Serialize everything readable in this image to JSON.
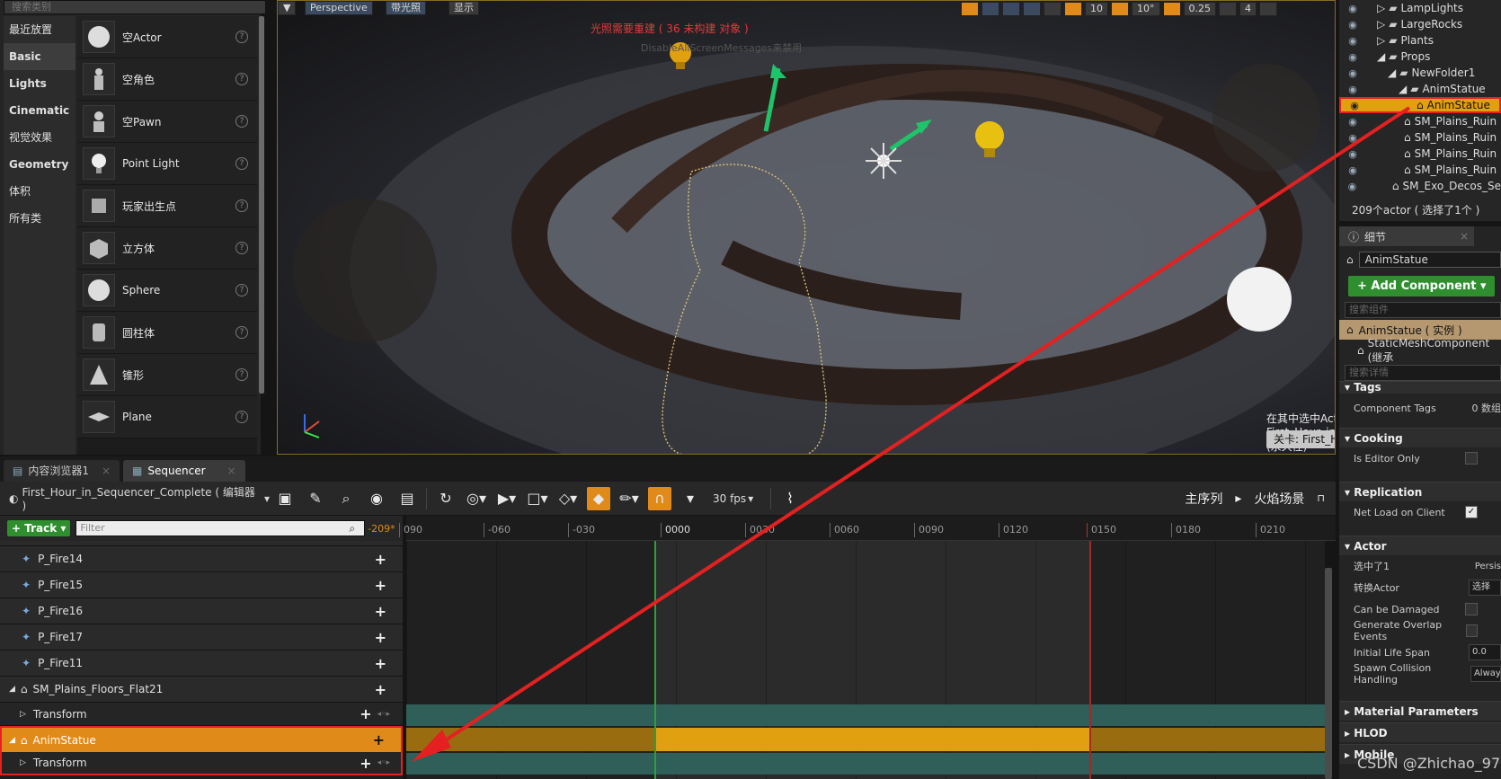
{
  "place_actors": {
    "search_placeholder": "搜索类别",
    "categories": [
      "最近放置",
      "Basic",
      "Lights",
      "Cinematic",
      "视觉效果",
      "Geometry",
      "体积",
      "所有类"
    ],
    "items": [
      "空Actor",
      "空角色",
      "空Pawn",
      "Point Light",
      "玩家出生点",
      "立方体",
      "Sphere",
      "圆柱体",
      "锥形",
      "Plane"
    ]
  },
  "viewport": {
    "perspective": "Perspective",
    "lit": "带光照",
    "show": "显示",
    "warning": "光照需要重建 ( 36 未构建 对象 )",
    "ghost_text": "DisableAllScreenMessages来禁用",
    "grid_snap": "10",
    "rot_snap": "10°",
    "scale_snap": "0.25",
    "cam_speed": "4",
    "selected_info": "在其中选中Actor： First_Hour_in_Sequencer_Complete (永久性)",
    "level": "关卡: First_Hour_in_Sequencer_Complete (永久性)"
  },
  "tabs": [
    {
      "label": "内容浏览器1",
      "icon": "content-browser-icon"
    },
    {
      "label": "Sequencer",
      "icon": "sequencer-icon"
    }
  ],
  "sequencer": {
    "sequence_name": "First_Hour_in_Sequencer_Complete ( 编辑器 )",
    "fps": "30 fps",
    "breadcrumb": [
      "主序列",
      "火焰场景"
    ],
    "add_track": "+ Track",
    "filter_placeholder": "Filter",
    "current_frame": "-209*",
    "tracks": [
      {
        "label": "P_Fire14",
        "type": "fire"
      },
      {
        "label": "P_Fire15",
        "type": "fire"
      },
      {
        "label": "P_Fire16",
        "type": "fire"
      },
      {
        "label": "P_Fire17",
        "type": "fire"
      },
      {
        "label": "P_Fire11",
        "type": "fire"
      },
      {
        "label": "SM_Plains_Floors_Flat21",
        "type": "mesh"
      },
      {
        "label": "Transform",
        "type": "sub"
      },
      {
        "label": "AnimStatue",
        "type": "selected"
      },
      {
        "label": "Transform",
        "type": "sub"
      }
    ],
    "ruler_ticks": [
      "090",
      "-060",
      "-030",
      "0000",
      "0030",
      "0060",
      "0090",
      "0120",
      "0150",
      "0180",
      "0210"
    ]
  },
  "outliner": {
    "rows": [
      {
        "label": "LampLights",
        "indent": 0
      },
      {
        "label": "LargeRocks",
        "indent": 0
      },
      {
        "label": "Plants",
        "indent": 0
      },
      {
        "label": "Props",
        "indent": 0
      },
      {
        "label": "NewFolder1",
        "indent": 1
      },
      {
        "label": "AnimStatue",
        "indent": 2
      },
      {
        "label": "AnimStatue",
        "indent": 3,
        "selected": true
      },
      {
        "label": "SM_Plains_Ruin",
        "indent": 3
      },
      {
        "label": "SM_Plains_Ruin",
        "indent": 3
      },
      {
        "label": "SM_Plains_Ruin",
        "indent": 3
      },
      {
        "label": "SM_Plains_Ruin",
        "indent": 3
      },
      {
        "label": "SM_Exo_Decos_Se",
        "indent": 2
      }
    ],
    "count": "209个actor ( 选择了1个 )"
  },
  "details": {
    "tab": "细节",
    "name": "AnimStatue",
    "add_component": "+ Add Component",
    "search_components": "搜索组件",
    "instance": "AnimStatue ( 实例 )",
    "component": "StaticMeshComponent (继承",
    "search_details": "搜索详情",
    "tags_header": "Tags",
    "component_tags": "Component Tags",
    "component_tags_val": "0 数组",
    "cooking": "Cooking",
    "is_editor_only": "Is Editor Only",
    "replication": "Replication",
    "net_load": "Net Load on Client",
    "actor": "Actor",
    "selected": "选中了1",
    "selected_val": "Persis",
    "convert": "转换Actor",
    "convert_val": "选择",
    "can_damage": "Can be Damaged",
    "overlap": "Generate Overlap Events",
    "life_span": "Initial Life Span",
    "life_span_val": "0.0",
    "spawn": "Spawn Collision Handling",
    "spawn_val": "Alway",
    "material_params": "Material Parameters",
    "hlod": "HLOD",
    "mobile": "Mobile"
  },
  "watermark": "CSDN @Zhichao_97",
  "colors": {
    "accent": "#e08a1a",
    "selection": "#e0a010",
    "arrow": "#e52020"
  }
}
